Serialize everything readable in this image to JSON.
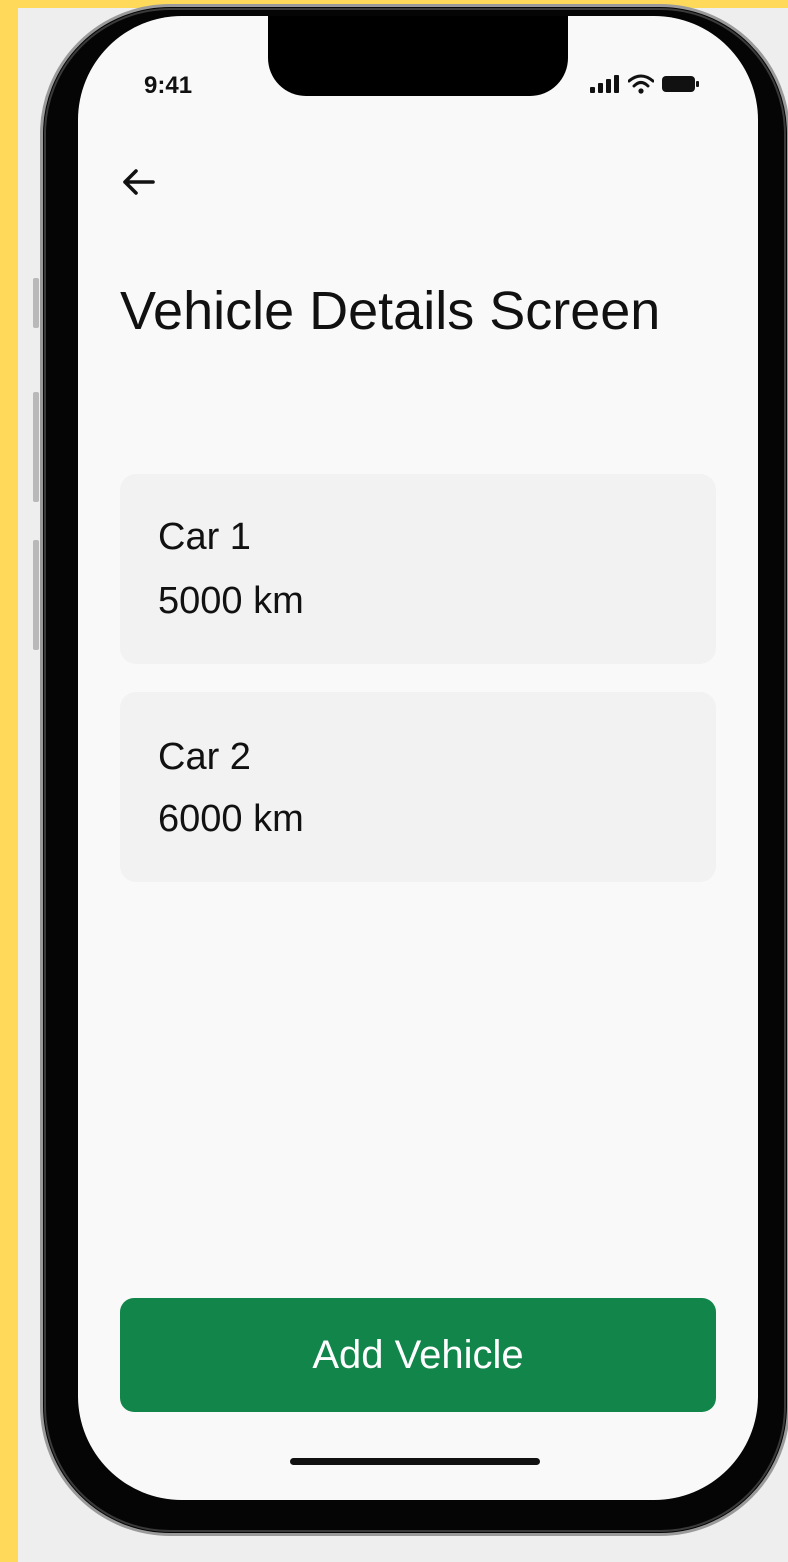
{
  "colors": {
    "background_accent": "#FFD95A",
    "primary_button": "#12864a",
    "card_background": "#f2f2f2",
    "screen_background": "#f9f9f9"
  },
  "status_bar": {
    "time": "9:41",
    "icons": [
      "cellular-signal-icon",
      "wifi-icon",
      "battery-icon"
    ]
  },
  "header": {
    "back_icon": "arrow-left-icon",
    "title": "Vehicle Details Screen"
  },
  "vehicles": [
    {
      "name": "Car 1",
      "distance": "5000 km"
    },
    {
      "name": "Car 2",
      "distance": "6000 km"
    }
  ],
  "actions": {
    "add_vehicle_label": "Add Vehicle"
  }
}
